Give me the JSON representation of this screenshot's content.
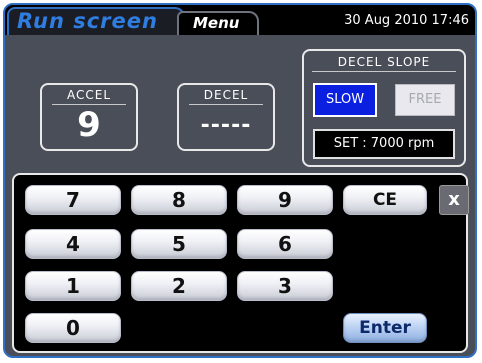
{
  "tabs": {
    "run": "Run screen",
    "menu": "Menu"
  },
  "datetime": "30 Aug 2010 17:46",
  "accel": {
    "label": "ACCEL",
    "value": "9"
  },
  "decel": {
    "label": "DECEL",
    "value": "-----"
  },
  "decel_slope": {
    "title": "DECEL SLOPE",
    "slow": "SLOW",
    "free": "FREE",
    "selected": "SLOW",
    "set": "SET :  7000 rpm"
  },
  "keypad": {
    "k7": "7",
    "k8": "8",
    "k9": "9",
    "k4": "4",
    "k5": "5",
    "k6": "6",
    "k1": "1",
    "k2": "2",
    "k3": "3",
    "k0": "0",
    "ce": "CE",
    "enter": "Enter",
    "close": "x"
  },
  "colors": {
    "accent": "#2f6fc4",
    "selected_button": "#0a1fe0",
    "panel_bg": "#4a4e59"
  }
}
